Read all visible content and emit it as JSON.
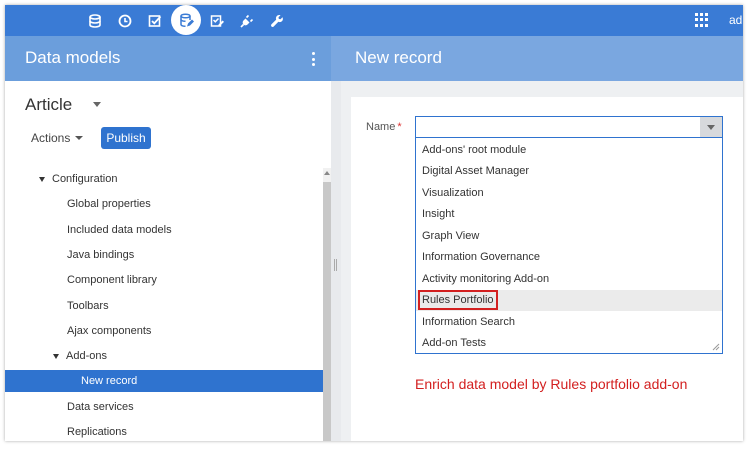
{
  "topbar": {
    "icons": [
      "database-icon",
      "clock-icon",
      "task-checkbox-icon",
      "data-model-icon",
      "edit-checklist-icon",
      "plug-icon",
      "wrench-icon"
    ],
    "active_icon": "data-model-icon",
    "apps_icon": "apps-grid-icon",
    "user_label": "ad",
    "accent_color": "#3a7bd5"
  },
  "left_header": {
    "title": "Data models"
  },
  "right_header": {
    "title": "New record"
  },
  "left_panel": {
    "model_title": "Article",
    "actions_label": "Actions",
    "publish_label": "Publish",
    "tree": [
      {
        "label": "Configuration",
        "expanded": true
      },
      {
        "label": "Global properties"
      },
      {
        "label": "Included data models"
      },
      {
        "label": "Java bindings"
      },
      {
        "label": "Component library"
      },
      {
        "label": "Toolbars"
      },
      {
        "label": "Ajax components"
      },
      {
        "label": "Add-ons",
        "expanded": true
      },
      {
        "label": "New record",
        "selected": true
      },
      {
        "label": "Data services"
      },
      {
        "label": "Replications"
      }
    ]
  },
  "form": {
    "name_label": "Name",
    "required_mark": "*",
    "selected_value": "",
    "options": [
      "Add-ons' root module",
      "Digital Asset Manager",
      "Visualization",
      "Insight",
      "Graph View",
      "Information Governance",
      "Activity monitoring Add-on",
      "Rules Portfolio",
      "Information Search",
      "Add-on Tests"
    ],
    "highlighted_option": "Rules Portfolio"
  },
  "annotation": {
    "text": "Enrich data model by Rules portfolio add-on",
    "color": "#d32020"
  }
}
